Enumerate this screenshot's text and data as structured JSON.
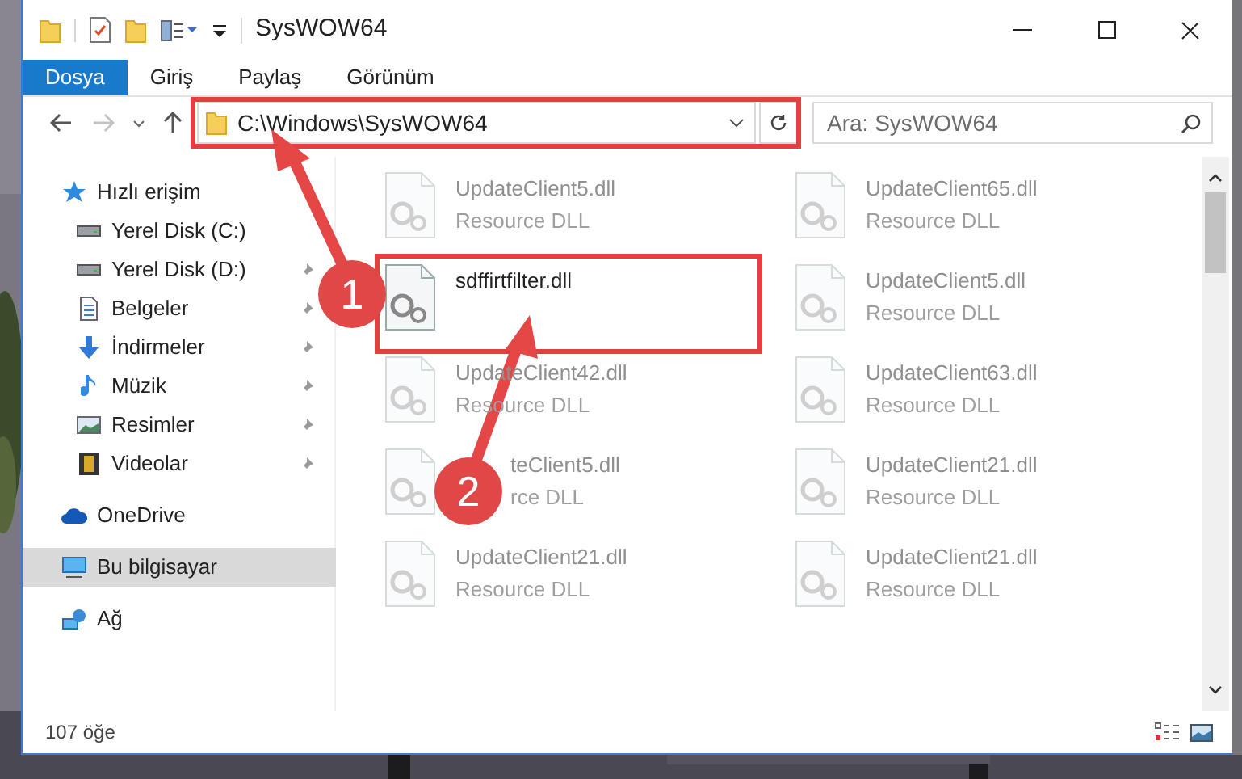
{
  "window": {
    "title": "SysWOW64"
  },
  "ribbon_tabs": [
    {
      "label": "Dosya",
      "selected": true
    },
    {
      "label": "Giriş",
      "selected": false
    },
    {
      "label": "Paylaş",
      "selected": false
    },
    {
      "label": "Görünüm",
      "selected": false
    }
  ],
  "address_bar": {
    "path": "C:\\Windows\\SysWOW64"
  },
  "search": {
    "placeholder": "Ara: SysWOW64"
  },
  "sidebar": {
    "items": [
      {
        "label": "Hızlı erişim",
        "kind": "star",
        "pinned": false,
        "selected": false,
        "children": [
          {
            "label": "Yerel Disk (C:)",
            "kind": "drive",
            "pinned": false,
            "selected": false
          },
          {
            "label": "Yerel Disk (D:)",
            "kind": "drive",
            "pinned": true,
            "selected": false
          },
          {
            "label": "Belgeler",
            "kind": "document",
            "pinned": true,
            "selected": false
          },
          {
            "label": "İndirmeler",
            "kind": "download",
            "pinned": true,
            "selected": false
          },
          {
            "label": "Müzik",
            "kind": "music",
            "pinned": true,
            "selected": false
          },
          {
            "label": "Resimler",
            "kind": "pictures",
            "pinned": true,
            "selected": false
          },
          {
            "label": "Videolar",
            "kind": "video",
            "pinned": true,
            "selected": false
          }
        ]
      },
      {
        "label": "OneDrive",
        "kind": "cloud",
        "pinned": false,
        "selected": false
      },
      {
        "label": "Bu bilgisayar",
        "kind": "computer",
        "pinned": false,
        "selected": true
      },
      {
        "label": "Ağ",
        "kind": "network",
        "pinned": false,
        "selected": false
      }
    ]
  },
  "files": [
    {
      "name": "UpdateClient5.dll",
      "type": "Resource DLL",
      "faded": true,
      "partly_hidden": false
    },
    {
      "name": "UpdateClient65.dll",
      "type": "Resource DLL",
      "faded": true,
      "partly_hidden": false
    },
    {
      "name": "sdffirtfilter.dll",
      "faded": false,
      "partly_hidden": false
    },
    {
      "name": "UpdateClient5.dll",
      "type": "Resource DLL",
      "faded": true,
      "partly_hidden": false
    },
    {
      "name": "UpdateClient42.dll",
      "type": "Resource DLL",
      "faded": true,
      "partly_hidden": false
    },
    {
      "name": "UpdateClient63.dll",
      "type": "Resource DLL",
      "faded": true,
      "partly_hidden": false
    },
    {
      "name": "teClient5.dll",
      "type": "rce DLL",
      "faded": true,
      "partly_hidden": true
    },
    {
      "name": "UpdateClient21.dll",
      "type": "Resource DLL",
      "faded": true,
      "partly_hidden": false
    },
    {
      "name": "UpdateClient21.dll",
      "type": "Resource DLL",
      "faded": true,
      "partly_hidden": false
    },
    {
      "name": "UpdateClient21.dll",
      "type": "Resource DLL",
      "faded": true,
      "partly_hidden": false
    }
  ],
  "status_bar": {
    "item_count": "107 öğe"
  },
  "callouts": [
    {
      "number": "1"
    },
    {
      "number": "2"
    }
  ]
}
